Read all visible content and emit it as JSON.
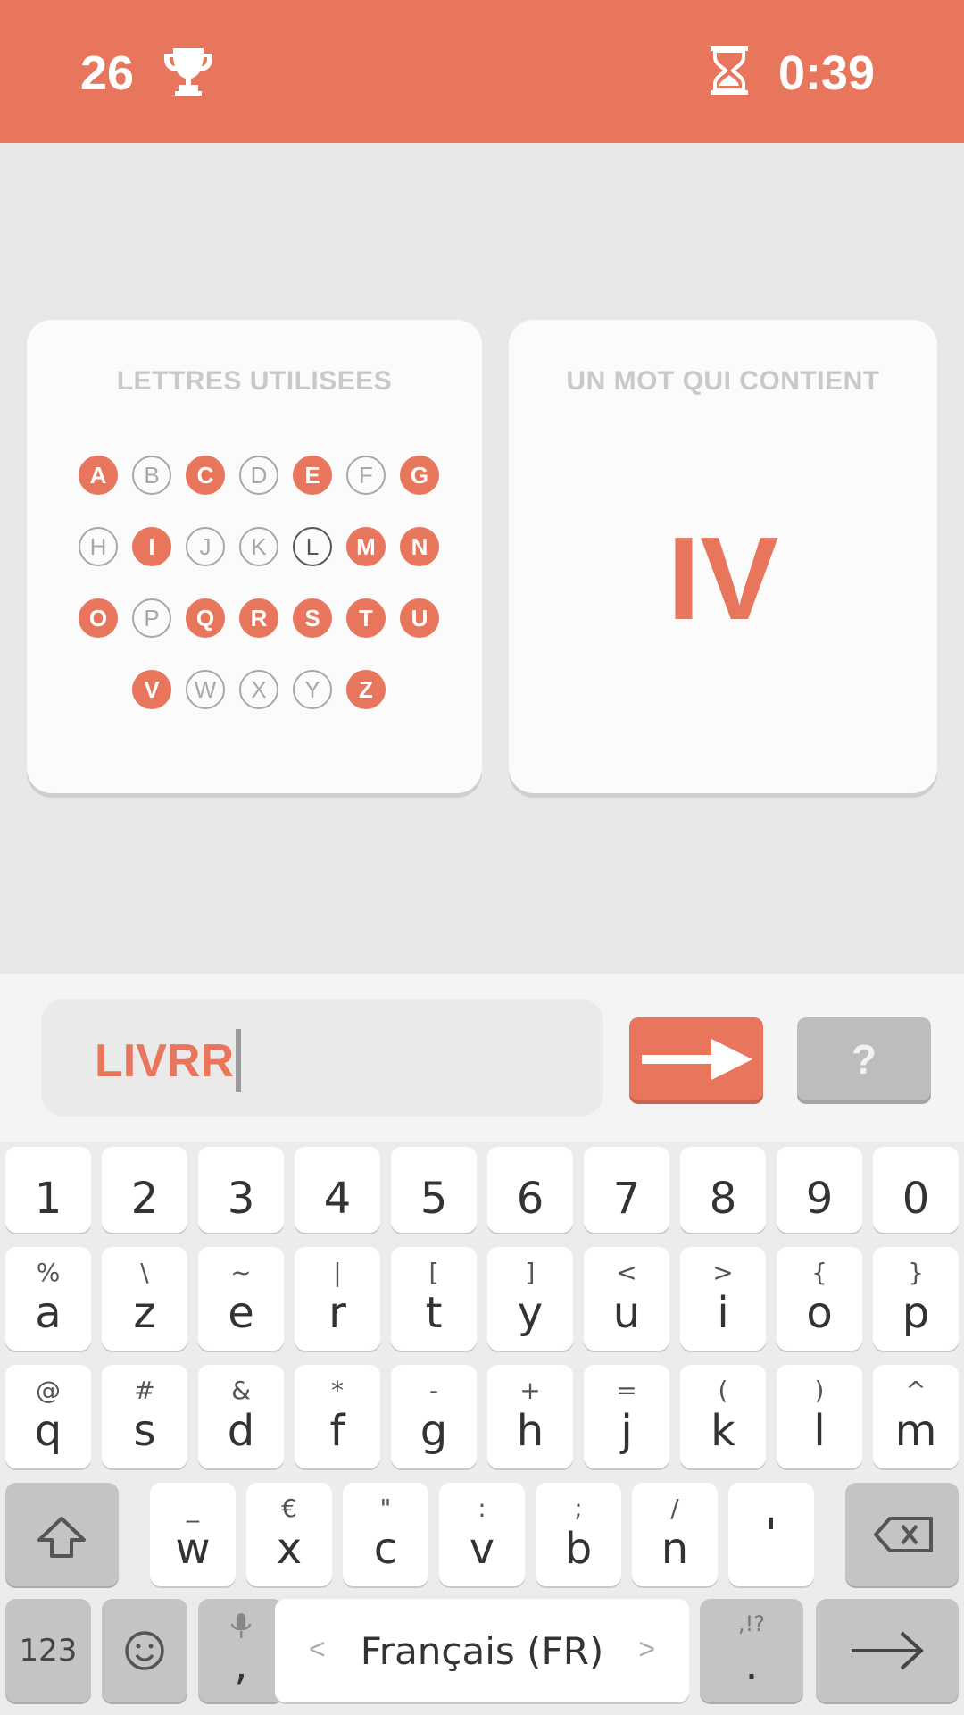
{
  "header": {
    "score": "26",
    "timer": "0:39",
    "icons": [
      "trophy-icon",
      "hourglass-icon"
    ],
    "bg_color": "#e8765c"
  },
  "left_card": {
    "title": "LETTRES UTILISEES",
    "rows": [
      [
        {
          "l": "A",
          "s": "used"
        },
        {
          "l": "B",
          "s": "unused"
        },
        {
          "l": "C",
          "s": "used"
        },
        {
          "l": "D",
          "s": "unused"
        },
        {
          "l": "E",
          "s": "used"
        },
        {
          "l": "F",
          "s": "unused"
        },
        {
          "l": "G",
          "s": "used"
        }
      ],
      [
        {
          "l": "H",
          "s": "unused"
        },
        {
          "l": "I",
          "s": "used"
        },
        {
          "l": "J",
          "s": "unused"
        },
        {
          "l": "K",
          "s": "unused"
        },
        {
          "l": "L",
          "s": "current"
        },
        {
          "l": "M",
          "s": "used"
        },
        {
          "l": "N",
          "s": "used"
        }
      ],
      [
        {
          "l": "O",
          "s": "used"
        },
        {
          "l": "P",
          "s": "unused"
        },
        {
          "l": "Q",
          "s": "used"
        },
        {
          "l": "R",
          "s": "used"
        },
        {
          "l": "S",
          "s": "used"
        },
        {
          "l": "T",
          "s": "used"
        },
        {
          "l": "U",
          "s": "used"
        }
      ],
      [
        {
          "l": "V",
          "s": "used"
        },
        {
          "l": "W",
          "s": "unused"
        },
        {
          "l": "X",
          "s": "unused"
        },
        {
          "l": "Y",
          "s": "unused"
        },
        {
          "l": "Z",
          "s": "used"
        }
      ]
    ]
  },
  "right_card": {
    "title": "UN MOT QUI CONTIENT",
    "syllable": "IV"
  },
  "input": {
    "value": "LIVRR",
    "submit_icon": "arrow-right-icon",
    "help_label": "?"
  },
  "keyboard": {
    "number_row": [
      "1",
      "2",
      "3",
      "4",
      "5",
      "6",
      "7",
      "8",
      "9",
      "0"
    ],
    "row1": [
      {
        "k": "a",
        "s": "%"
      },
      {
        "k": "z",
        "s": "\\"
      },
      {
        "k": "e",
        "s": "~"
      },
      {
        "k": "r",
        "s": "|"
      },
      {
        "k": "t",
        "s": "["
      },
      {
        "k": "y",
        "s": "]"
      },
      {
        "k": "u",
        "s": "<"
      },
      {
        "k": "i",
        "s": ">"
      },
      {
        "k": "o",
        "s": "{"
      },
      {
        "k": "p",
        "s": "}"
      }
    ],
    "row2": [
      {
        "k": "q",
        "s": "@"
      },
      {
        "k": "s",
        "s": "#"
      },
      {
        "k": "d",
        "s": "&"
      },
      {
        "k": "f",
        "s": "*"
      },
      {
        "k": "g",
        "s": "-"
      },
      {
        "k": "h",
        "s": "+"
      },
      {
        "k": "j",
        "s": "="
      },
      {
        "k": "k",
        "s": "("
      },
      {
        "k": "l",
        "s": ")"
      },
      {
        "k": "m",
        "s": "^"
      }
    ],
    "row3": [
      {
        "k": "w",
        "s": "_"
      },
      {
        "k": "x",
        "s": "€"
      },
      {
        "k": "c",
        "s": "\""
      },
      {
        "k": "v",
        "s": ":"
      },
      {
        "k": "b",
        "s": ";"
      },
      {
        "k": "n",
        "s": "/"
      },
      {
        "k": "'",
        "s": ""
      }
    ],
    "symbols_label": "123",
    "comma_label": ",",
    "space_label": "Français (FR)",
    "period_label": ".",
    "period_sub": ",!?",
    "space_left_arrow": "<",
    "space_right_arrow": ">"
  }
}
